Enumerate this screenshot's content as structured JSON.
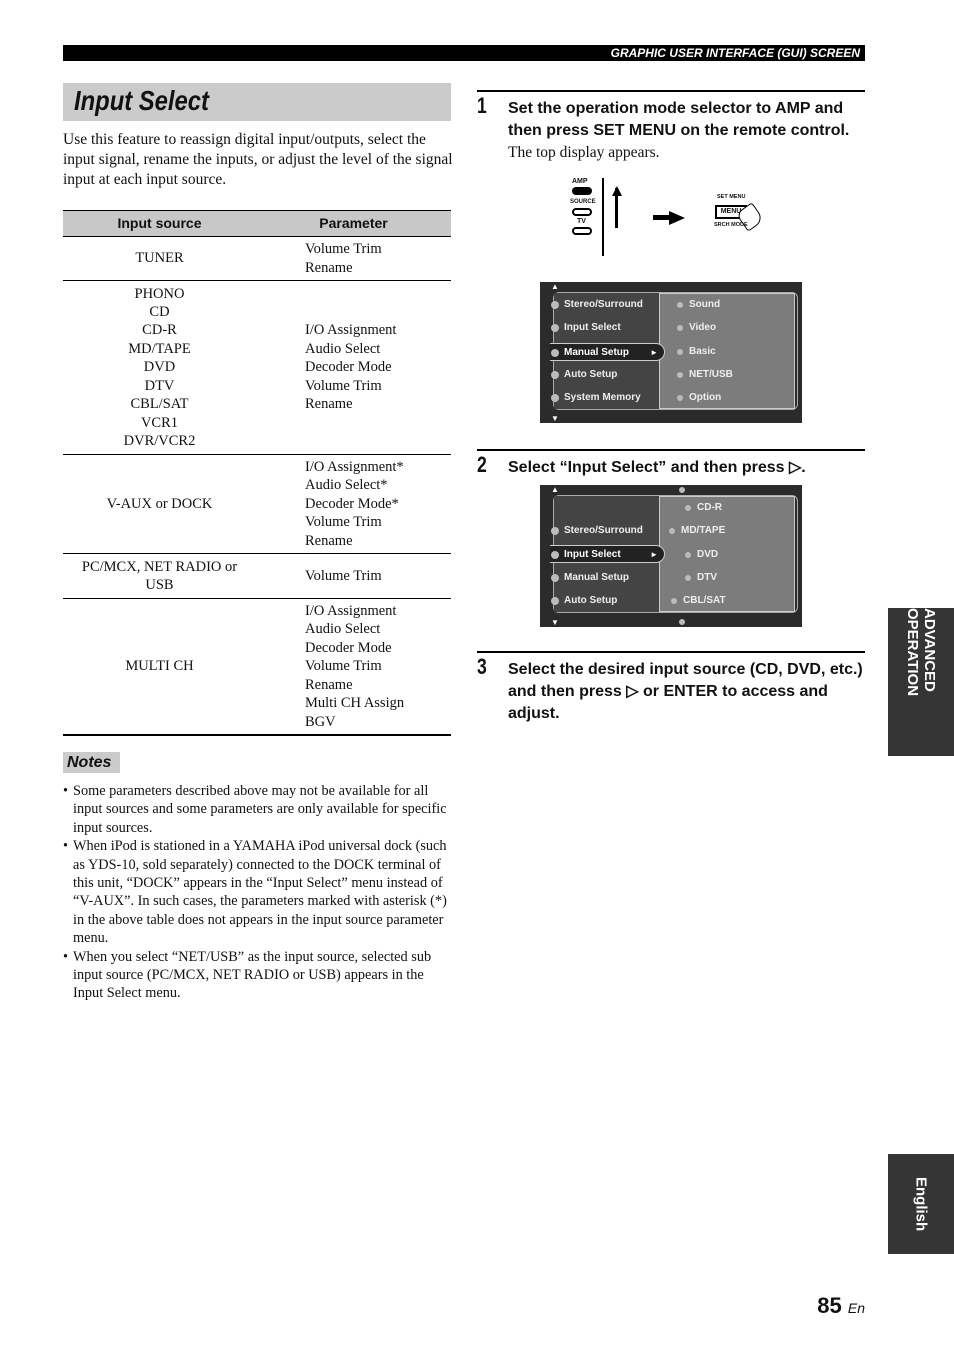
{
  "header": {
    "section": "GRAPHIC USER INTERFACE (GUI) SCREEN"
  },
  "title": "Input Select",
  "intro": "Use this feature to reassign digital input/outputs, select the input signal, rename the inputs, or adjust the level of the signal input at each input source.",
  "table": {
    "headers": [
      "Input source",
      "Parameter"
    ],
    "rows": [
      {
        "source": [
          "TUNER"
        ],
        "params": [
          "Volume Trim",
          "Rename"
        ]
      },
      {
        "source": [
          "PHONO",
          "CD",
          "CD-R",
          "MD/TAPE",
          "DVD",
          "DTV",
          "CBL/SAT",
          "VCR1",
          "DVR/VCR2"
        ],
        "params": [
          "I/O Assignment",
          "Audio Select",
          "Decoder Mode",
          "Volume Trim",
          "Rename"
        ]
      },
      {
        "source": [
          "V-AUX or DOCK"
        ],
        "params": [
          "I/O Assignment*",
          "Audio Select*",
          "Decoder Mode*",
          "Volume Trim",
          "Rename"
        ]
      },
      {
        "source": [
          "PC/MCX, NET RADIO or",
          "USB"
        ],
        "params": [
          "Volume Trim"
        ]
      },
      {
        "source": [
          "MULTI CH"
        ],
        "params": [
          "I/O Assignment",
          "Audio Select",
          "Decoder Mode",
          "Volume Trim",
          "Rename",
          "Multi CH Assign",
          "BGV"
        ]
      }
    ]
  },
  "notes": {
    "label": "Notes",
    "items": [
      "Some parameters described above may not be available for all input sources and some parameters are only available for specific input sources.",
      "When iPod is stationed in a YAMAHA iPod universal dock (such as YDS-10, sold separately) connected to the DOCK terminal of this unit, “DOCK” appears in the “Input Select” menu instead of “V-AUX”. In such cases, the parameters marked with asterisk (*) in the above table does not appears in the input source parameter menu.",
      "When you select “NET/USB” as the input source, selected sub input source (PC/MCX, NET RADIO or USB) appears in the Input Select menu."
    ]
  },
  "steps": [
    {
      "num": "1",
      "text": "Set the operation mode selector to AMP and then press SET MENU on the remote control.",
      "sub": "The top display appears."
    },
    {
      "num": "2",
      "text": "Select “Input Select” and then press ▷."
    },
    {
      "num": "3",
      "text": "Select the desired input source (CD, DVD, etc.) and then press ▷ or ENTER to access and adjust."
    }
  ],
  "remote": {
    "amp": "AMP",
    "source": "SOURCE",
    "tv": "TV",
    "set_menu": "SET MENU",
    "menu": "MENU",
    "srch_mode": "SRCH MODE"
  },
  "gui1": {
    "left": [
      "Stereo/Surround",
      "Input Select",
      "Manual Setup",
      "Auto Setup",
      "System Memory"
    ],
    "selected": 2,
    "right": [
      "Sound",
      "Video",
      "Basic",
      "NET/USB",
      "Option"
    ]
  },
  "gui2": {
    "left": [
      "Stereo/Surround",
      "Input Select",
      "Manual Setup",
      "Auto Setup"
    ],
    "selected": 1,
    "right": [
      "CD-R",
      "MD/TAPE",
      "DVD",
      "DTV",
      "CBL/SAT"
    ]
  },
  "side_tabs": [
    "ADVANCED OPERATION",
    "English"
  ],
  "page": {
    "number": "85",
    "lang": "En"
  }
}
